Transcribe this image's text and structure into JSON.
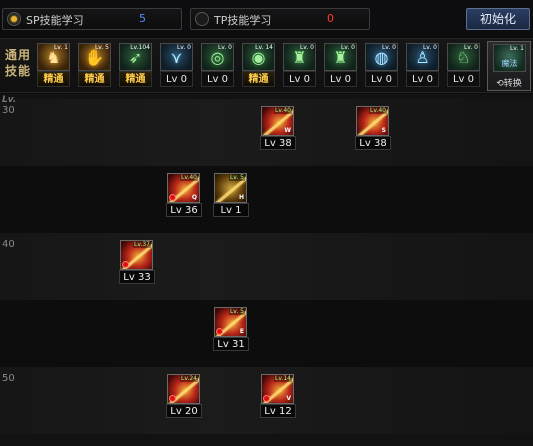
{
  "top": {
    "sp_label": "SP技能学习",
    "sp_value": "5",
    "tp_label": "TP技能学习",
    "tp_value": "0",
    "reset_label": "初始化"
  },
  "common": {
    "title": "通用技能",
    "slots": [
      {
        "icon": "crouch-pose-icon",
        "lv": "Lv. 1",
        "caption": "精通",
        "style": "gold"
      },
      {
        "icon": "golden-hand-icon",
        "lv": "Lv. 5",
        "caption": "精通",
        "style": "gold"
      },
      {
        "icon": "green-runner-icon",
        "lv": "Lv.104",
        "caption": "精通",
        "style": "green"
      },
      {
        "icon": "blue-wings-icon",
        "lv": "Lv. 0",
        "caption": "Lv 0",
        "style": "blue"
      },
      {
        "icon": "green-target-icon",
        "lv": "Lv. 0",
        "caption": "Lv 0",
        "style": "green"
      },
      {
        "icon": "green-target-icon",
        "lv": "Lv. 14",
        "caption": "精通",
        "style": "green"
      },
      {
        "icon": "green-figure-icon",
        "lv": "Lv. 0",
        "caption": "Lv 0",
        "style": "green"
      },
      {
        "icon": "green-figure-icon",
        "lv": "Lv. 0",
        "caption": "Lv 0",
        "style": "green"
      },
      {
        "icon": "blue-eye-icon",
        "lv": "Lv. 0",
        "caption": "Lv 0",
        "style": "blue"
      },
      {
        "icon": "blue-figure-icon",
        "lv": "Lv. 0",
        "caption": "Lv 0",
        "style": "blue"
      },
      {
        "icon": "green-creature-icon",
        "lv": "Lv. 0",
        "caption": "Lv 0",
        "style": "green"
      }
    ],
    "swap_lv": "Lv. 1",
    "swap_tag": "魔法",
    "swap_label": "⟲转换"
  },
  "tree": {
    "header": "Lv.",
    "rows": [
      "30",
      "40",
      "50"
    ],
    "skills": [
      {
        "lv": "Lv.40",
        "key": "W",
        "caption": "Lv 38"
      },
      {
        "lv": "Lv.40",
        "key": "S",
        "caption": "Lv 38"
      },
      {
        "lv": "Lv.40",
        "key": "Q",
        "caption": "Lv 36"
      },
      {
        "lv": "Lv. 5",
        "key": "H",
        "caption": "Lv 1"
      },
      {
        "lv": "Lv.37",
        "key": "",
        "caption": "Lv 33"
      },
      {
        "lv": "Lv. 5",
        "key": "E",
        "caption": "Lv 31"
      },
      {
        "lv": "Lv.24",
        "key": "",
        "caption": "Lv 20"
      },
      {
        "lv": "Lv.14",
        "key": "V",
        "caption": "Lv 12"
      }
    ]
  },
  "colors": {
    "sp_value": "#4d8dff",
    "tp_value": "#ff3a2a",
    "master_text": "#ffcb4a",
    "reset_button": "#2b3f63"
  }
}
